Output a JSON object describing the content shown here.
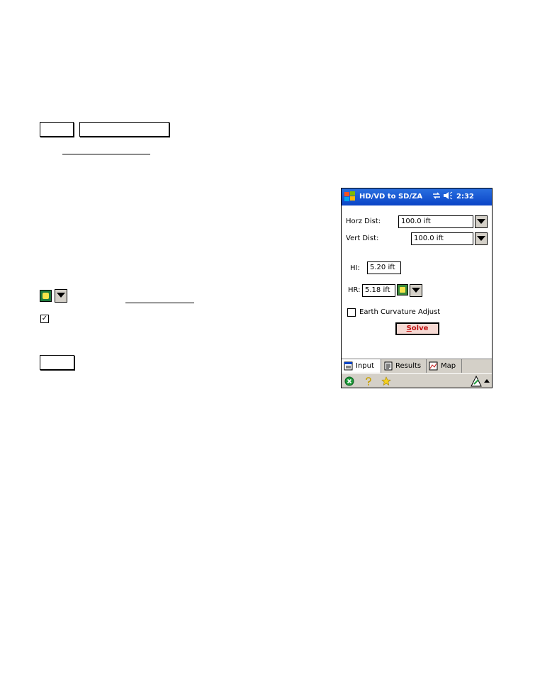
{
  "device": {
    "titlebar": {
      "title": "HD/VD to SD/ZA",
      "status_icons": [
        "sync-icon",
        "speaker-icon"
      ],
      "time": "2:32"
    },
    "form": {
      "horz_dist_label": "Horz Dist:",
      "horz_dist_value": "100.0 ift",
      "vert_dist_label": "Vert Dist:",
      "vert_dist_value": "100.0 ift",
      "hi_label": "HI:",
      "hi_value": "5.20 ift",
      "hr_label": "HR:",
      "hr_value": "5.18 ift",
      "earth_curvature_label": "Earth Curvature Adjust",
      "earth_curvature_checked": false,
      "solve_label": "Solve"
    },
    "tabs": [
      {
        "label": "Input",
        "icon": "input-tab-icon",
        "active": true
      },
      {
        "label": "Results",
        "icon": "results-tab-icon",
        "active": false
      },
      {
        "label": "Map",
        "icon": "map-tab-icon",
        "active": false
      }
    ],
    "commandbar": {
      "icons": [
        "close-icon",
        "help-icon",
        "favorites-icon",
        "input-panel-icon"
      ]
    }
  },
  "colors": {
    "titlebar": "#0a44c6",
    "solve_text": "#c01010",
    "gps_icon": "#3c8a3c",
    "chrome": "#d4d0c8"
  }
}
